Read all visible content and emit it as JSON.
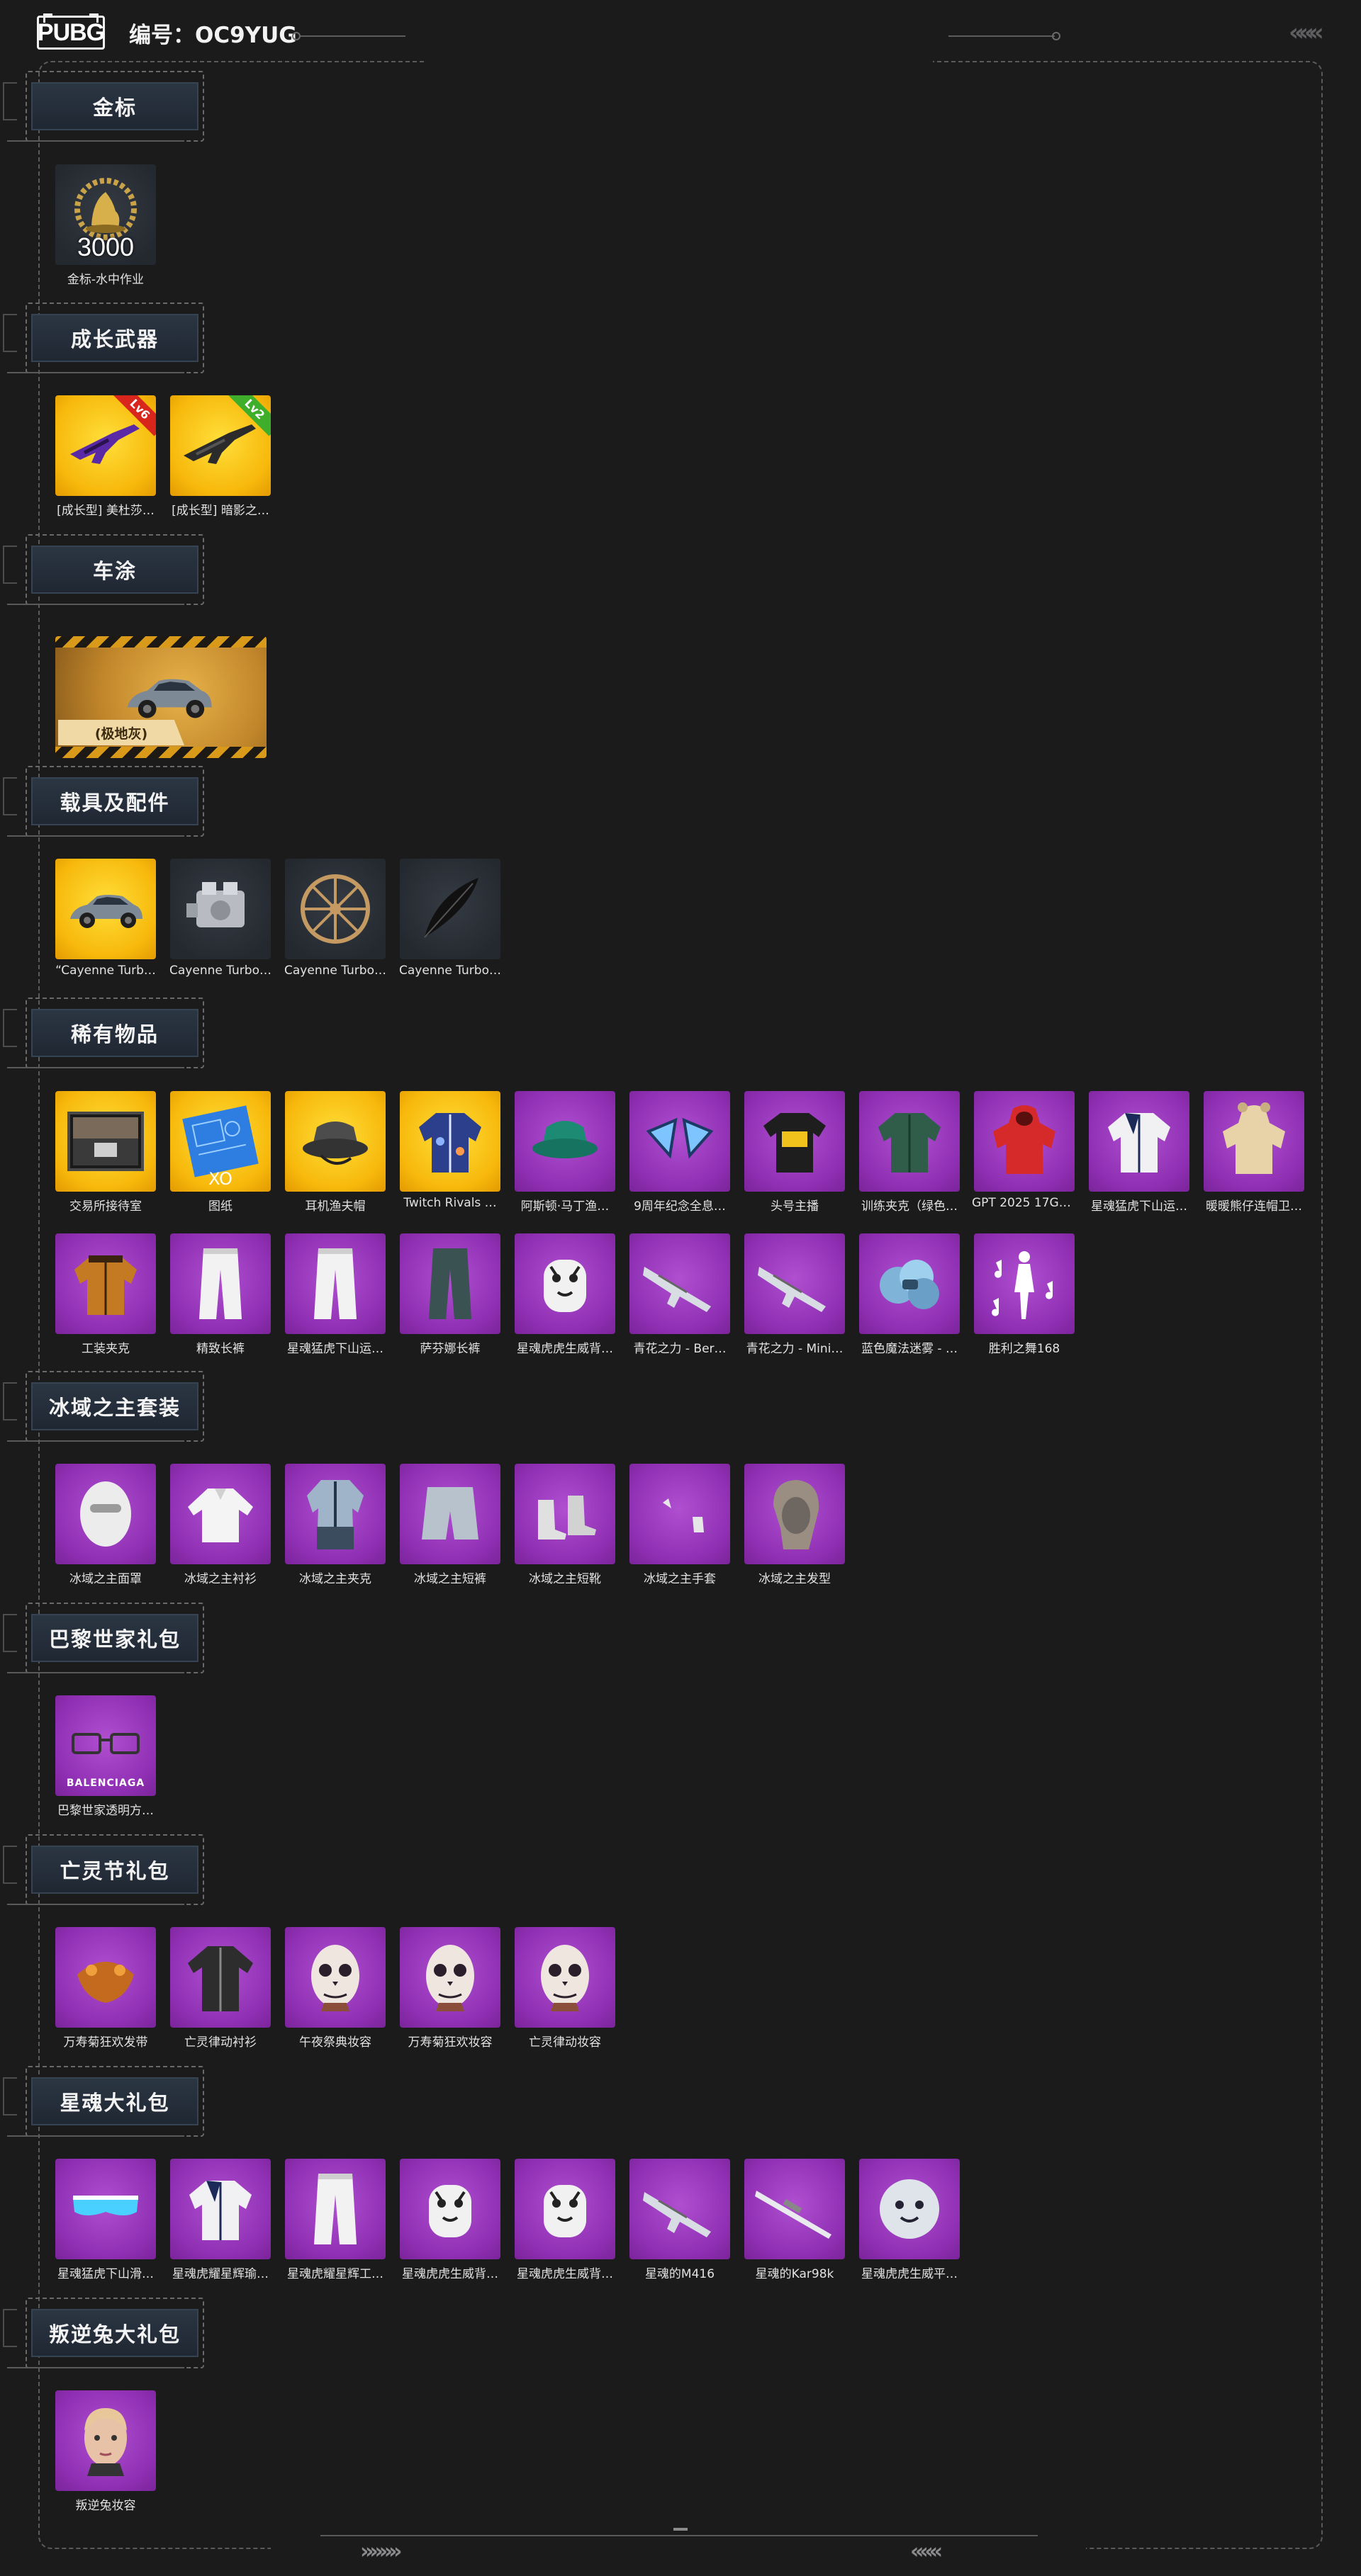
{
  "header": {
    "logo": "PUBG",
    "order_label": "编号：OC9YUG",
    "chevrons": "«««"
  },
  "footer": {
    "chev_left": "»»»»",
    "chev_right": "«««"
  },
  "sections": [
    {
      "title": "金标",
      "items": [
        {
          "name": "金标-水中作业",
          "bg": "dark",
          "icon": "gold-badge",
          "badge": "3000"
        }
      ]
    },
    {
      "title": "成长武器",
      "items": [
        {
          "name": "[成长型] 美杜莎…",
          "bg": "gold",
          "icon": "rifle-purple",
          "level": "Lv6",
          "level_color": "#d8261c"
        },
        {
          "name": "[成长型] 暗影之…",
          "bg": "gold",
          "icon": "rifle-dark",
          "level": "Lv2",
          "level_color": "#3fae2a"
        }
      ]
    },
    {
      "title": "车涂",
      "plate": {
        "label": "(极地灰)",
        "icon": "suv-car"
      }
    },
    {
      "title": "载具及配件",
      "items": [
        {
          "name": "“Cayenne Turb…",
          "bg": "gold",
          "icon": "suv-car"
        },
        {
          "name": "Cayenne Turbo…",
          "bg": "dark",
          "icon": "engine"
        },
        {
          "name": "Cayenne Turbo…",
          "bg": "dark",
          "icon": "wheel"
        },
        {
          "name": "Cayenne Turbo…",
          "bg": "dark",
          "icon": "feather"
        }
      ]
    },
    {
      "title": "稀有物品",
      "items": [
        {
          "name": "交易所接待室",
          "bg": "gold",
          "icon": "room"
        },
        {
          "name": "图纸",
          "bg": "gold",
          "icon": "blueprint",
          "extra": "XO"
        },
        {
          "name": "耳机渔夫帽",
          "bg": "gold",
          "icon": "bucket-hat"
        },
        {
          "name": "Twitch Rivals …",
          "bg": "gold",
          "icon": "jacket-blue"
        },
        {
          "name": "阿斯顿·马丁渔…",
          "bg": "purple",
          "icon": "bucket-hat-green"
        },
        {
          "name": "9周年纪念全息…",
          "bg": "purple",
          "icon": "ears"
        },
        {
          "name": "头号主播",
          "bg": "purple",
          "icon": "tshirt"
        },
        {
          "name": "训练夹克（绿色…",
          "bg": "purple",
          "icon": "jacket-green"
        },
        {
          "name": "GPT 2025 17Ga…",
          "bg": "purple",
          "icon": "hoodie-red"
        },
        {
          "name": "星魂猛虎下山运…",
          "bg": "purple",
          "icon": "jacket-white"
        },
        {
          "name": "暖暖熊仔连帽卫…",
          "bg": "purple",
          "icon": "hoodie-bear"
        },
        {
          "name": "工装夹克",
          "bg": "purple",
          "icon": "jacket-orange"
        },
        {
          "name": "精致长裤",
          "bg": "purple",
          "icon": "pants-white"
        },
        {
          "name": "星魂猛虎下山运…",
          "bg": "purple",
          "icon": "pants-white"
        },
        {
          "name": "萨芬娜长裤",
          "bg": "purple",
          "icon": "pants-dark"
        },
        {
          "name": "星魂虎虎生威背…",
          "bg": "purple",
          "icon": "tiger-backpack"
        },
        {
          "name": "青花之力 - Ber…",
          "bg": "purple",
          "icon": "rifle-silver"
        },
        {
          "name": "青花之力 - Mini…",
          "bg": "purple",
          "icon": "rifle-silver"
        },
        {
          "name": "蓝色魔法迷雾 - …",
          "bg": "purple",
          "icon": "smoke"
        },
        {
          "name": "胜利之舞168",
          "bg": "purple",
          "icon": "dance"
        }
      ]
    },
    {
      "title": "冰域之主套装",
      "items": [
        {
          "name": "冰域之主面罩",
          "bg": "purple",
          "icon": "mask-white"
        },
        {
          "name": "冰域之主衬衫",
          "bg": "purple",
          "icon": "shirt-white"
        },
        {
          "name": "冰域之主夹克",
          "bg": "purple",
          "icon": "coat-grey"
        },
        {
          "name": "冰域之主短裤",
          "bg": "purple",
          "icon": "shorts"
        },
        {
          "name": "冰域之主短靴",
          "bg": "purple",
          "icon": "boots"
        },
        {
          "name": "冰域之主手套",
          "bg": "purple",
          "icon": "gloves"
        },
        {
          "name": "冰域之主发型",
          "bg": "purple",
          "icon": "hair"
        }
      ]
    },
    {
      "title": "巴黎世家礼包",
      "items": [
        {
          "name": "巴黎世家透明方…",
          "bg": "purple",
          "icon": "glasses",
          "brand": "BALENCIAGA"
        }
      ]
    },
    {
      "title": "亡灵节礼包",
      "items": [
        {
          "name": "万寿菊狂欢发带",
          "bg": "purple",
          "icon": "headband"
        },
        {
          "name": "亡灵律动衬衫",
          "bg": "purple",
          "icon": "shirt-dark"
        },
        {
          "name": "午夜祭典妆容",
          "bg": "purple",
          "icon": "skull-face"
        },
        {
          "name": "万寿菊狂欢妆容",
          "bg": "purple",
          "icon": "skull-face"
        },
        {
          "name": "亡灵律动妆容",
          "bg": "purple",
          "icon": "skull-face"
        }
      ]
    },
    {
      "title": "星魂大礼包",
      "items": [
        {
          "name": "星魂猛虎下山滑…",
          "bg": "purple",
          "icon": "goggles"
        },
        {
          "name": "星魂虎耀星辉瑜…",
          "bg": "purple",
          "icon": "jacket-white"
        },
        {
          "name": "星魂虎耀星辉工…",
          "bg": "purple",
          "icon": "pants-white"
        },
        {
          "name": "星魂虎虎生威背…",
          "bg": "purple",
          "icon": "tiger-backpack"
        },
        {
          "name": "星魂虎虎生威背…",
          "bg": "purple",
          "icon": "tiger-backpack"
        },
        {
          "name": "星魂的M416",
          "bg": "purple",
          "icon": "rifle-silver"
        },
        {
          "name": "星魂的Kar98k",
          "bg": "purple",
          "icon": "sniper"
        },
        {
          "name": "星魂虎虎生威平…",
          "bg": "purple",
          "icon": "tiger-head"
        }
      ]
    },
    {
      "title": "叛逆兔大礼包",
      "items": [
        {
          "name": "叛逆兔妆容",
          "bg": "purple",
          "icon": "woman-face"
        }
      ]
    }
  ]
}
